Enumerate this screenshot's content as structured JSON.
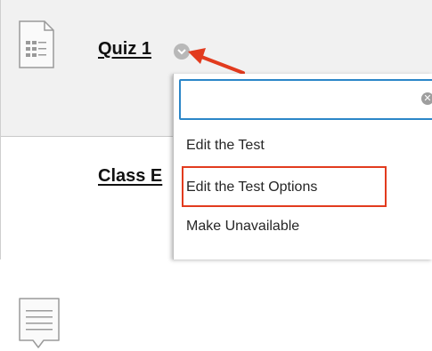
{
  "items": [
    {
      "title": "Quiz 1",
      "icon": "quiz-document-icon"
    },
    {
      "title": "Class E",
      "icon": "discussion-message-icon"
    }
  ],
  "menu": {
    "search_value": "",
    "items": [
      {
        "label": "Edit the Test"
      },
      {
        "label": "Edit the Test Options"
      },
      {
        "label": "Make Unavailable"
      }
    ]
  },
  "colors": {
    "row_highlight": "#f1f1f1",
    "search_border": "#2b86c8",
    "annotation_red": "#e23b1e"
  }
}
